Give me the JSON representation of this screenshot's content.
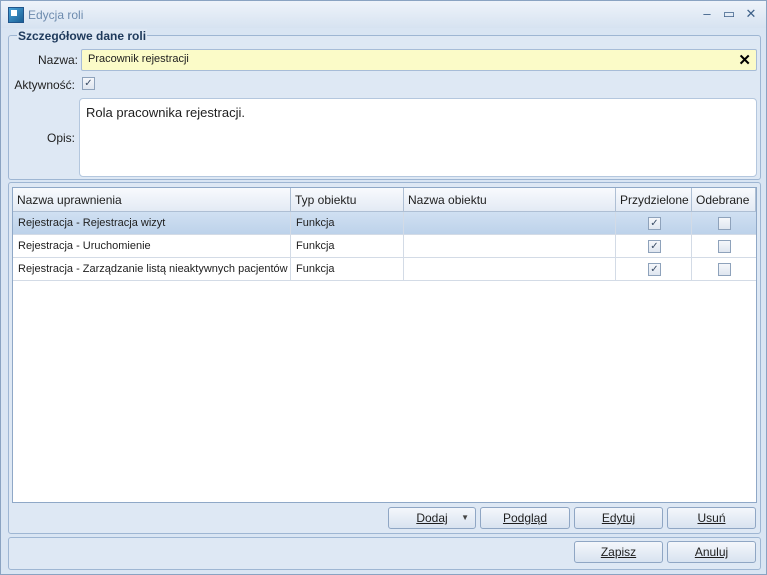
{
  "window": {
    "title": "Edycja roli"
  },
  "group": {
    "title": "Szczegółowe dane roli"
  },
  "form": {
    "name_label": "Nazwa:",
    "name_value": "Pracownik rejestracji",
    "active_label": "Aktywność:",
    "active_checked": true,
    "desc_label": "Opis:",
    "desc_value": "Rola pracownika rejestracji."
  },
  "table": {
    "columns": [
      "Nazwa uprawnienia",
      "Typ obiektu",
      "Nazwa obiektu",
      "Przydzielone",
      "Odebrane"
    ],
    "rows": [
      {
        "name": "Rejestracja - Rejestracja wizyt",
        "type": "Funkcja",
        "object": "",
        "granted": true,
        "revoked": false,
        "selected": true
      },
      {
        "name": "Rejestracja - Uruchomienie",
        "type": "Funkcja",
        "object": "",
        "granted": true,
        "revoked": false,
        "selected": false
      },
      {
        "name": "Rejestracja - Zarządzanie listą nieaktywnych pacjentów",
        "type": "Funkcja",
        "object": "",
        "granted": true,
        "revoked": false,
        "selected": false
      }
    ]
  },
  "buttons": {
    "add": "Dodaj",
    "preview": "Podgląd",
    "edit": "Edytuj",
    "remove": "Usuń",
    "save": "Zapisz",
    "cancel": "Anuluj"
  },
  "icons": {
    "app": "app-icon",
    "minimize": "minimize-icon",
    "maximize": "maximize-icon",
    "close": "close-icon",
    "clear": "clear-icon",
    "check": "check-icon"
  }
}
